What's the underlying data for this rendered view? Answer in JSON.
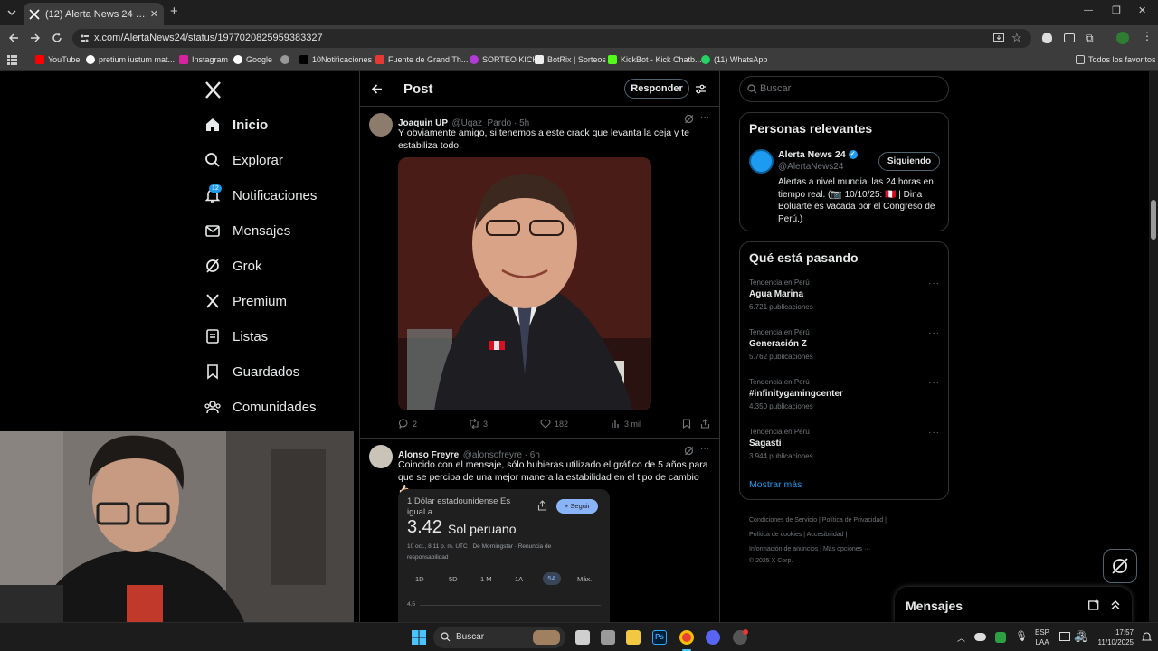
{
  "browser": {
    "tab_title": "(12) Alerta News 24 en X: \"PE | A",
    "url": "x.com/AlertaNews24/status/1977020825959383327",
    "bookmarks": [
      "YouTube",
      "pretium iustum mat...",
      "Instagram",
      "Google",
      "",
      "10Notificaciones",
      "Fuente de Grand Th...",
      "SORTEO KICK",
      "BotRix | Sorteos",
      "KickBot - Kick Chatb...",
      "(11) WhatsApp"
    ],
    "all_favorites": "Todos los favoritos"
  },
  "nav": {
    "items": [
      {
        "label": "Inicio"
      },
      {
        "label": "Explorar"
      },
      {
        "label": "Notificaciones"
      },
      {
        "label": "Mensajes"
      },
      {
        "label": "Grok"
      },
      {
        "label": "Premium"
      },
      {
        "label": "Listas"
      },
      {
        "label": "Guardados"
      },
      {
        "label": "Comunidades"
      }
    ],
    "notif_badge": "12"
  },
  "post_header": {
    "title": "Post",
    "reply_button": "Responder"
  },
  "tweets": [
    {
      "name": "Joaquin UP",
      "handle": "@Ugaz_Pardo · 5h",
      "text": "Y obviamente amigo, si tenemos a este crack que levanta la ceja y te estabiliza todo.",
      "replies": "2",
      "reposts": "3",
      "likes": "182",
      "views": "3 mil"
    },
    {
      "name": "Alonso Freyre",
      "handle": "@alonsofreyre · 6h",
      "text": "Coincido con el mensaje, sólo hubieras utilizado el gráfico de 5 años para que se perciba de una mejor manera la estabilidad en el tipo de cambio 👍🏻.",
      "card": {
        "line1": "1 Dólar estadounidense Es",
        "line2": "igual a",
        "value": "3.42",
        "currency": "Sol peruano",
        "meta1": "10 oct., 8:11 p. m. UTC · De Morningstar · Renuncia de",
        "meta2": "responsabilidad",
        "follow": "Seguir",
        "ranges": [
          "1D",
          "5D",
          "1 M",
          "1A",
          "5A",
          "Máx."
        ],
        "axis_label": "4.5"
      }
    }
  ],
  "search": {
    "placeholder": "Buscar"
  },
  "relevant": {
    "title": "Personas relevantes",
    "name": "Alerta News 24",
    "handle": "@AlertaNews24",
    "follow_state": "Siguiendo",
    "bio": "Alertas a nivel mundial las 24 horas en tiempo real. (📷 10/10/25: 🇵🇪 | Dina Boluarte es vacada por el Congreso de Perú.)"
  },
  "trending": {
    "title": "Qué está pasando",
    "items": [
      {
        "meta": "Tendencia en Perú",
        "name": "Agua Marina",
        "count": "6.721 publicaciones"
      },
      {
        "meta": "Tendencia en Perú",
        "name": "Generación Z",
        "count": "5.762 publicaciones"
      },
      {
        "meta": "Tendencia en Perú",
        "name": "#infinitygamingcenter",
        "count": "4.350 publicaciones"
      },
      {
        "meta": "Tendencia en Perú",
        "name": "Sagasti",
        "count": "3.944 publicaciones"
      }
    ],
    "show_more": "Mostrar más"
  },
  "footer": {
    "line1": "Condiciones de Servicio  |  Política de Privacidad  |",
    "line2": "Política de cookies  |  Accesibilidad  |",
    "line3": "Información de anuncios  |  Más opciones ···",
    "line4": "© 2025 X Corp."
  },
  "messages_drawer": {
    "title": "Mensajes"
  },
  "taskbar": {
    "search": "Buscar",
    "lang1": "ESP",
    "lang2": "LAA",
    "time": "17:57",
    "date": "11/10/2025"
  },
  "colors": {
    "accent": "#1d9bf0",
    "bg": "#000000",
    "border": "#2f3336",
    "muted": "#71767b"
  }
}
